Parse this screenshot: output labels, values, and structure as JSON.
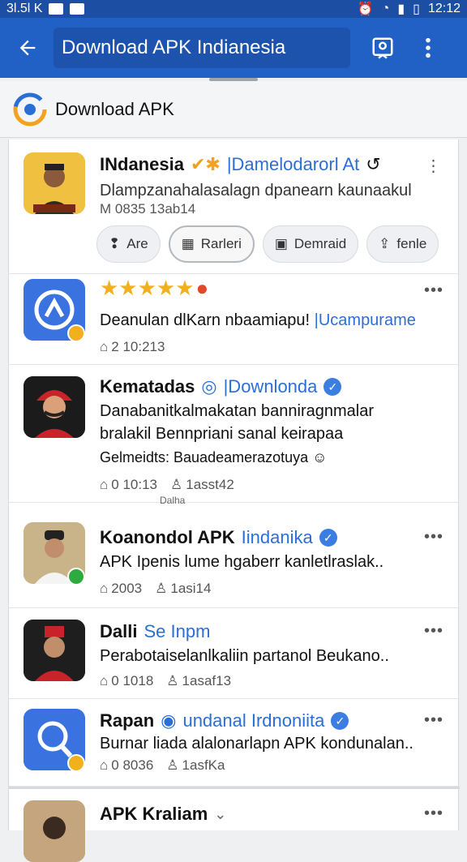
{
  "status_bar": {
    "left_text": "3l.5l K",
    "time": "12:12"
  },
  "app_bar": {
    "search_value": "Download APK Indianesia"
  },
  "header": {
    "title": "Download APK"
  },
  "items": [
    {
      "title": "INdanesia",
      "source": "|Damelodarorl At",
      "desc": "Dlampzanahalasalagn dpanearn kaunaakul",
      "meta": "M 0835  13ab14",
      "chips": [
        "Are",
        "Rarleri",
        "Demraid",
        "fenle"
      ]
    },
    {
      "rating_stars": 5,
      "desc_a": "Deanulan dlKarn nbaamiapu! ",
      "desc_b": "|Ucampurame",
      "meta1": "2 10:213"
    },
    {
      "title": "Kematadas",
      "source": "|Downlonda",
      "desc_line1": "Danabanitkalmakatan banniragnmalar",
      "desc_line2": "bralakil Bennpriani sanal keirapaa",
      "desc_line3": "Gelmeidts: Bauadeamerazotuya",
      "meta1": "0 10:13",
      "meta2": "1asst42",
      "sub_label": "Dalha"
    },
    {
      "title": "Koanondol APK",
      "source": "Iindanika",
      "desc": "APK Ipenis lume hgaberr kanletlraslak..",
      "meta1": "2003",
      "meta2": "1asi14"
    },
    {
      "title": "Dalli",
      "source": "Se Inpm",
      "desc": "Perabotaiselanlkaliin partanol Beukano..",
      "meta1": "0 1018",
      "meta2": "1asaf13"
    },
    {
      "title": "Rapan",
      "source": "undanal Irdnoniita",
      "desc": "Burnar liada alalonarlapn APK kondunalan..",
      "meta1": "0 8036",
      "meta2": "1asfKa"
    },
    {
      "title": "APK Kraliam"
    }
  ],
  "colors": {
    "app_bar": "#2160c4",
    "accent": "#3b7de0",
    "star": "#f2b01e"
  }
}
